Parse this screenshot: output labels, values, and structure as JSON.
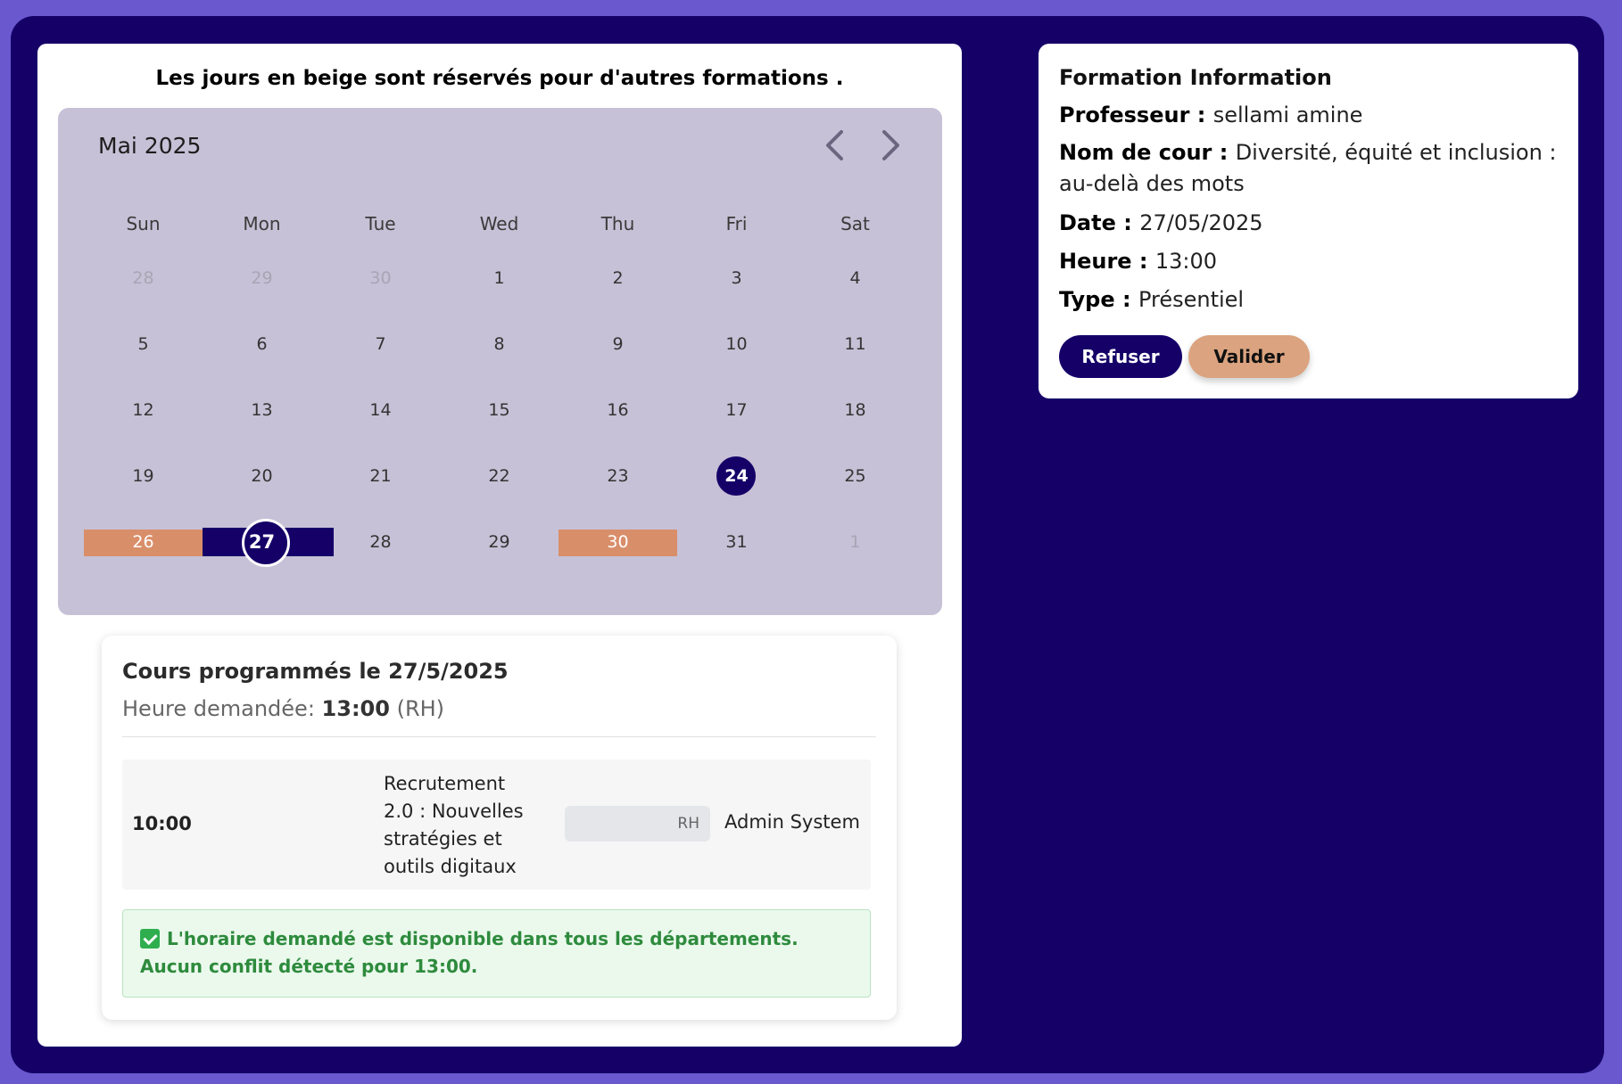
{
  "notice": "Les jours en beige sont réservés pour d'autres formations .",
  "calendar": {
    "month_label": "Mai 2025",
    "weekdays": [
      "Sun",
      "Mon",
      "Tue",
      "Wed",
      "Thu",
      "Fri",
      "Sat"
    ],
    "weeks": [
      [
        "28",
        "29",
        "30",
        "1",
        "2",
        "3",
        "4"
      ],
      [
        "5",
        "6",
        "7",
        "8",
        "9",
        "10",
        "11"
      ],
      [
        "12",
        "13",
        "14",
        "15",
        "16",
        "17",
        "18"
      ],
      [
        "19",
        "20",
        "21",
        "22",
        "23",
        "24",
        "25"
      ],
      [
        "26",
        "27",
        "28",
        "29",
        "30",
        "31",
        "1"
      ]
    ],
    "colors": {
      "reserved": "#d98e6a",
      "selected": "#150068",
      "today": "#150068"
    }
  },
  "schedule": {
    "title": "Cours programmés le 27/5/2025",
    "requested_prefix": "Heure demandée: ",
    "requested_time": "13:00",
    "requested_suffix": " (RH)",
    "courses": [
      {
        "time": "10:00",
        "title": "Recrutement 2.0 : Nouvelles stratégies et outils digitaux",
        "department": "RH",
        "owner": "Admin System"
      }
    ],
    "status_line1": "L'horaire demandé est disponible dans tous les départements.",
    "status_line2": "Aucun conflit détecté pour 13:00."
  },
  "info": {
    "title": "Formation Information",
    "professor_label": "Professeur : ",
    "professor": "sellami amine",
    "course_label": "Nom de cour : ",
    "course": "Diversité, équité et inclusion : au-delà des mots",
    "date_label": "Date : ",
    "date": "27/05/2025",
    "hour_label": "Heure : ",
    "hour": "13:00",
    "type_label": "Type : ",
    "type": "Présentiel",
    "refuse_label": "Refuser",
    "validate_label": "Valider"
  }
}
